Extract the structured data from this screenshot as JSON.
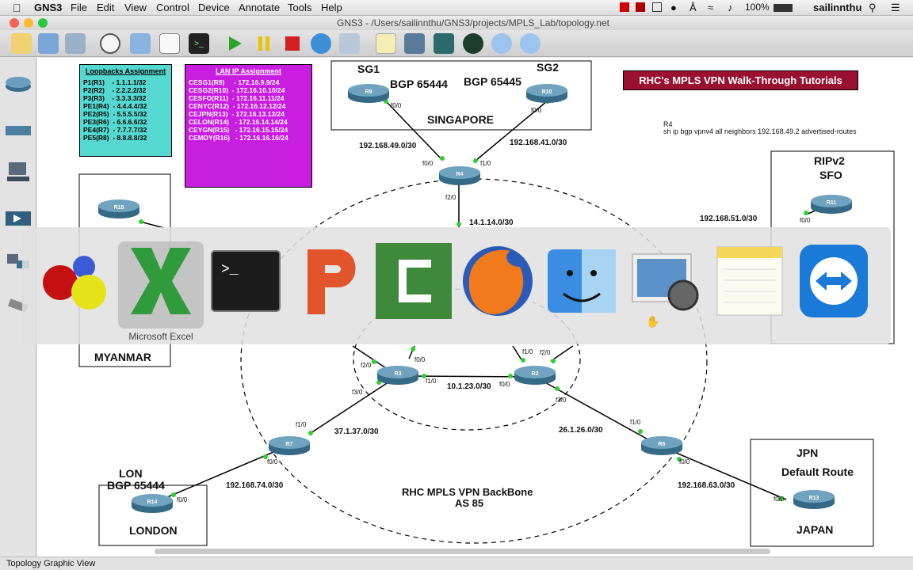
{
  "menubar": {
    "app_name": "GNS3",
    "items": [
      "File",
      "Edit",
      "View",
      "Control",
      "Device",
      "Annotate",
      "Tools",
      "Help"
    ],
    "battery": "100%",
    "user": "sailinnthu"
  },
  "window": {
    "title": "GNS3 - /Users/sailinnthu/GNS3/projects/MPLS_Lab/topology.net"
  },
  "status_bar": {
    "text": "Topology Graphic View"
  },
  "banner": {
    "text": "RHC's MPLS VPN Walk-Through Tutorials"
  },
  "note": {
    "line1": "R4",
    "line2": "sh ip bgp vpnv4 all neighbors 192.168.49.2 advertised-routes"
  },
  "loopbacks": {
    "title": "Loopbacks Assignment",
    "rows": [
      "P1(R1)    - 1.1.1.1/32",
      "P2(R2)    - 2.2.2.2/32",
      "P3(R3)    - 3.3.3.3/32",
      "",
      "PE1(R4)  - 4.4.4.4/32",
      "PE2(R5)  - 5.5.5.5/32",
      "PE3(R6)  - 6.6.6.6/32",
      "PE4(R7)  - 7.7.7.7/32",
      "PE5(R8)  - 8.8.8.8/32"
    ]
  },
  "lan_ip": {
    "title": "LAN IP Assignment",
    "rows": [
      "CESG1(R9)     - 172.16.9.9/24",
      "CESG2(R10)  - 172.16.10.10/24",
      "",
      "CESFO(R11)  - 172.16.11.11/24",
      "CENYC(R12)  - 172.16.12.12/24",
      "",
      "CEJPN(R13)  - 172.16.13.13/24",
      "",
      "CELON(R14)   - 172.16.14.14/24",
      "",
      "CEYGN(R15)   - 172.16.15.15/24",
      "CEMDY(R16)   - 172.16.16.16/24"
    ]
  },
  "sites": {
    "singapore": {
      "sg1": "SG1",
      "sg2": "SG2",
      "bgp1": "BGP 65444",
      "bgp2": "BGP 65445",
      "name": "SINGAPORE"
    },
    "sfo": {
      "line1": "RIPv2",
      "line2": "SFO"
    },
    "myanmar": {
      "name": "MYANMAR"
    },
    "london": {
      "line1": "LON",
      "line2": "BGP 65444",
      "name": "LONDON"
    },
    "japan": {
      "line1": "JPN",
      "line2": "Default Route",
      "name": "JAPAN"
    },
    "backbone": {
      "line1": "RHC MPLS VPN BackBone",
      "line2": "AS 85"
    }
  },
  "routers": {
    "r9": "R9",
    "r10": "R10",
    "r4": "R4",
    "r11": "R11",
    "r15": "R15",
    "r3": "R3",
    "r2": "R2",
    "r7": "R7",
    "r6": "R6",
    "r14": "R14",
    "r13": "R13"
  },
  "networks": {
    "n49": "192.168.49.0/30",
    "n41": "192.168.41.0/30",
    "n14": "14.1.14.0/30",
    "n51": "192.168.51.0/30",
    "n123": "10.1.23.0/30",
    "n137": "37.1.37.0/30",
    "n126": "26.1.26.0/30",
    "n74": "192.168.74.0/30",
    "n63": "192.168.63.0/30"
  },
  "interfaces": {
    "f00": "f0/0",
    "f10": "f1/0",
    "f20": "f2/0",
    "f30": "f3/0"
  },
  "dock": {
    "hover_label": "Microsoft Excel"
  }
}
